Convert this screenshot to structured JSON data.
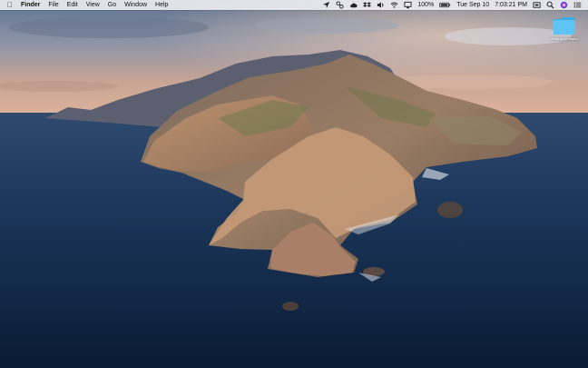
{
  "menubar": {
    "app_name": "Finder",
    "menus": [
      "File",
      "Edit",
      "View",
      "Go",
      "Window",
      "Help"
    ],
    "status_icons": [
      "location-arrow-icon",
      "network-link-icon",
      "cloud-icon",
      "dropbox-icon",
      "sound-icon",
      "wifi-icon",
      "airplay-icon"
    ],
    "battery": "100%",
    "date": "Tue Sep 10",
    "time": "7:03:21 PM",
    "right_icons": [
      "screen-capture-icon",
      "spotlight-search-icon",
      "siri-icon",
      "notification-center-icon"
    ]
  },
  "desktop": {
    "folder": {
      "label_line1": "Waiting for status",
      "icon": "folder-icon",
      "color": "#4fb8f2"
    }
  },
  "colors": {
    "menubar_bg": "#ececf0",
    "sea_deep": "#0c2240",
    "sky_warm": "#d9a58f"
  }
}
